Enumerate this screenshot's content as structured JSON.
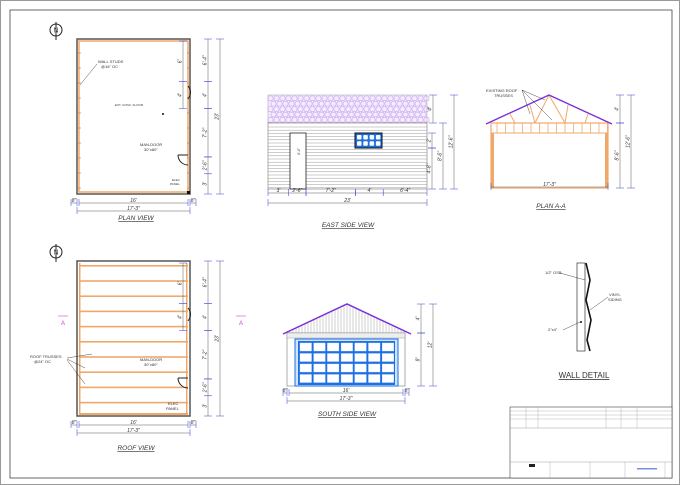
{
  "north_label": "N",
  "plan_view": {
    "title": "PLAN VIEW",
    "notes": {
      "wall_studs": [
        "WALL STUDS",
        "@16\" OC"
      ],
      "floor": "EXT. CONC. FLOOR",
      "man_door": [
        "MAN-DOOR",
        "30\"x80\""
      ],
      "elec": [
        "ELEC",
        "PANEL"
      ]
    },
    "dims_right": [
      "6'-4\"",
      "4'",
      "7'-2\"",
      "2'-6\"",
      "3'"
    ],
    "dims_inner": [
      "6'",
      "4'"
    ],
    "dim_total_right": "23'",
    "dims_bottom": [
      "8\"",
      "16'",
      "8\""
    ],
    "dim_total_bottom": "17'-3\""
  },
  "roof_view": {
    "title": "ROOF VIEW",
    "notes": {
      "trusses": [
        "ROOF TRUSSES",
        "@24\" OC"
      ],
      "man_door": [
        "MAN-DOOR",
        "30\"x80\""
      ],
      "elec": [
        "ELEC",
        "PANEL"
      ]
    },
    "section_marker": "A",
    "dims_right": [
      "6'-4\"",
      "4'",
      "7'-2\"",
      "2'-6\"",
      "3'"
    ],
    "dims_inner": [
      "6'",
      "4'"
    ],
    "dim_total_right": "23'",
    "dims_bottom": [
      "8\"",
      "16'",
      "8\""
    ],
    "dim_total_bottom": "17'-3\""
  },
  "east_view": {
    "title": "EAST SIDE VIEW",
    "dims_bottom": [
      "3'",
      "2'-6\"",
      "7'-2\"",
      "4'",
      "6'-4\""
    ],
    "dim_total": "23'",
    "dims_right": [
      "4'",
      "2'",
      "4'-8\"",
      "8'-6\"",
      "12'-6\""
    ],
    "door_dim": "6'-8\""
  },
  "plan_aa": {
    "title": "PLAN A-A",
    "note": [
      "EXISTING ROOF",
      "TRUSSES"
    ],
    "dims_right": [
      "4'",
      "8'-6\"",
      "12'-6\""
    ],
    "dim_bottom": "17'-3\""
  },
  "south_view": {
    "title": "SOUTH SIDE VIEW",
    "dims_right": [
      "4'",
      "8'",
      "12'"
    ],
    "dims_bottom": [
      "8\"",
      "16'",
      "8\""
    ],
    "dim_total": "17'-3\""
  },
  "wall_detail": {
    "title": "WALL DETAIL",
    "notes": {
      "osb": "1/2\" OSB",
      "siding": [
        "VINYL",
        "SIDING"
      ],
      "stud": "2\"x4\""
    }
  },
  "colors": {
    "wood": "#f0a86a",
    "roof": "#7a2fd8",
    "dim": "#3040e0",
    "window": "#1e6fe0",
    "shingle": "#c9a6f0",
    "marker": "#d040d0"
  }
}
